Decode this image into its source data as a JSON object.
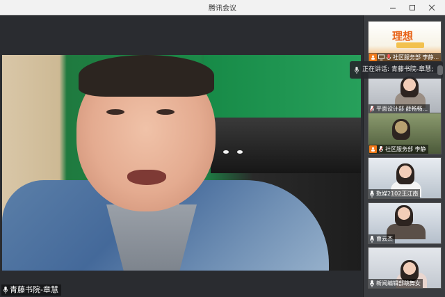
{
  "window": {
    "title": "腾讯会议"
  },
  "main_video": {
    "speaker_label": "青藤书院-章慧"
  },
  "speaking_indicator": {
    "text": "正在讲话: 青藤书院-章慧;"
  },
  "participants": [
    {
      "label": "社区服务部 李静...",
      "has_host_badge": true,
      "banner_text": "理想"
    },
    {
      "label": "平面设计部 薛畅畅..."
    },
    {
      "label": "社区服务部 李静",
      "has_host_badge": true
    },
    {
      "label": "数媒2102王江南"
    },
    {
      "label": "曹云杰"
    },
    {
      "label": "新闻编辑部跳舞女"
    }
  ],
  "colors": {
    "accent_orange": "#f07a1a",
    "titlebar_bg": "#f2f2f2",
    "sidebar_bg": "#3a3c40"
  }
}
